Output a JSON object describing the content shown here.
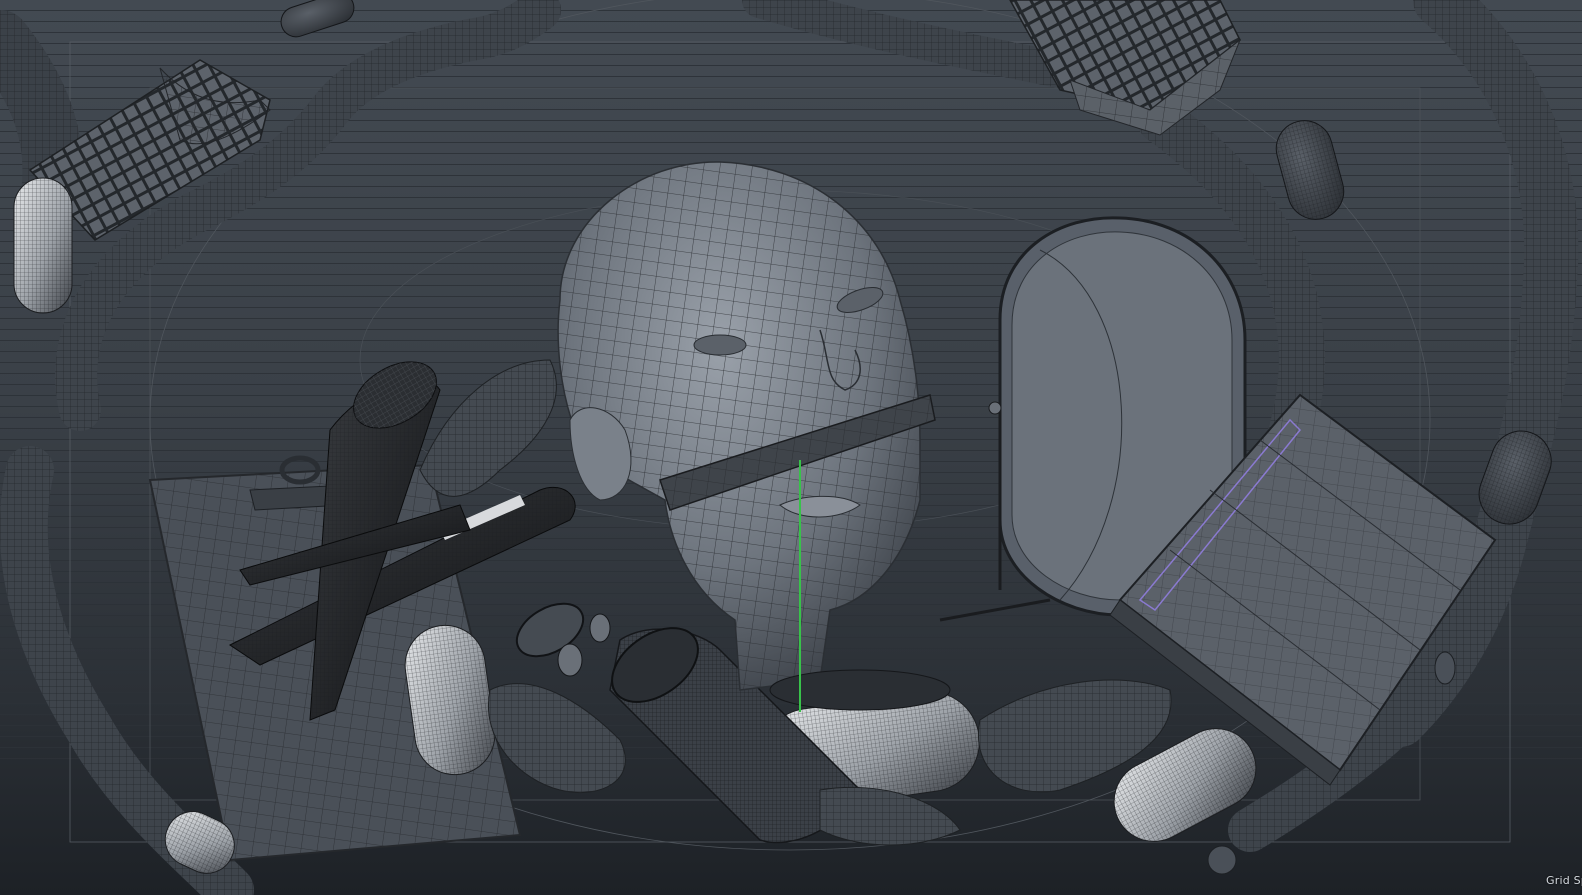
{
  "viewport": {
    "grid_readout": "Grid Sp"
  },
  "colors": {
    "background_top": "#434a52",
    "background_bottom": "#1d2126",
    "mesh_fill": "#4a5058",
    "wire": "#1b1d20",
    "highlight_wire": "#e8eaec",
    "axis_green": "#38c24a",
    "selection_purple": "#8a7ad0"
  }
}
